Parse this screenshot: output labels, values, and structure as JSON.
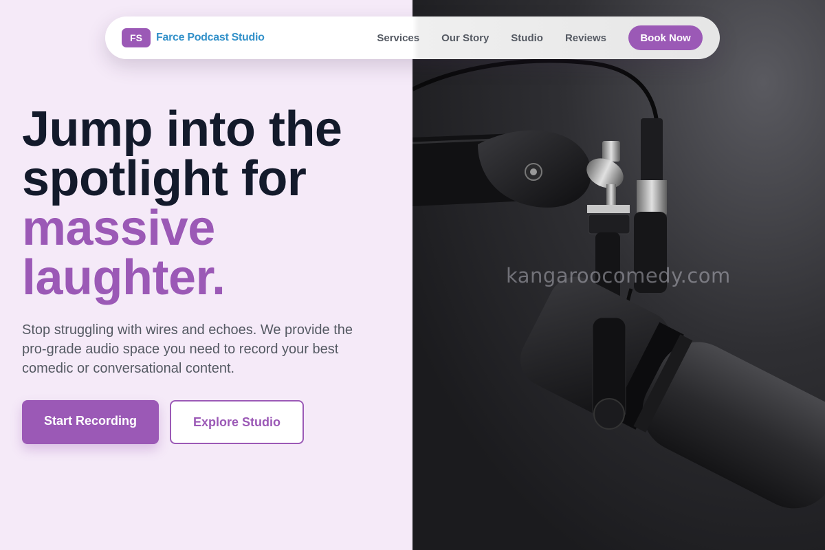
{
  "brand": {
    "badge": "FS",
    "name": "Farce Podcast Studio"
  },
  "nav": {
    "links": [
      "Services",
      "Our Story",
      "Studio",
      "Reviews"
    ],
    "cta": "Book Now"
  },
  "hero": {
    "headline_line1": "Jump into the",
    "headline_line2": "spotlight for",
    "headline_accent1": "massive",
    "headline_accent2": "laughter.",
    "subtext": "Stop struggling with wires and echoes. We provide the pro-grade audio space you need to record your best comedic or conversational content.",
    "primary_button": "Start Recording",
    "secondary_button": "Explore Studio"
  },
  "image": {
    "subject": "microphone-photo",
    "watermark": "kangaroocomedy.com"
  },
  "colors": {
    "accent": "#9b59b6",
    "brand_text": "#3391c9",
    "heading": "#131a2b",
    "background": "#f5eaf8"
  }
}
